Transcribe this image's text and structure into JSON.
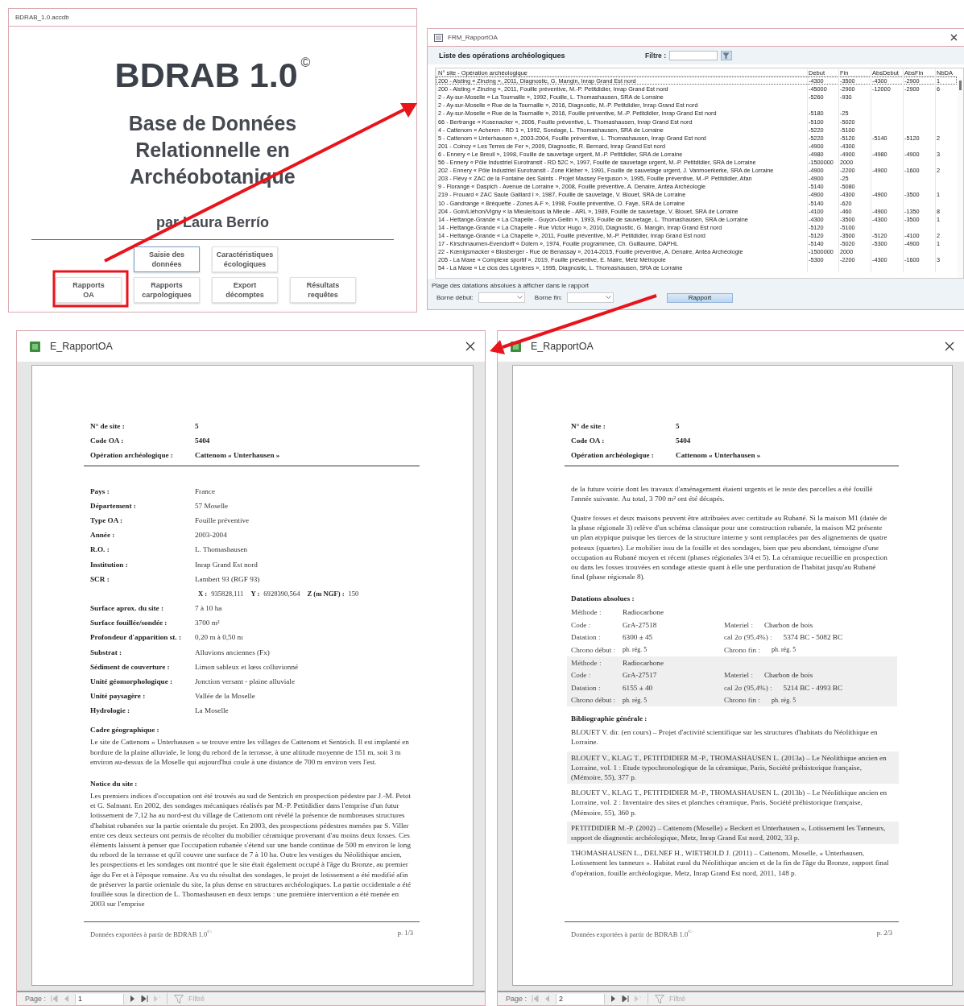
{
  "main_window": {
    "title": "BDRAB_1.0.accdb",
    "app_name": "BDRAB 1.0",
    "copyright": "©",
    "subtitle_lines": [
      "Base de Données",
      "Relationnelle en",
      "Archéobotanique"
    ],
    "author": "par Laura Berrío",
    "button_rows": [
      [
        {
          "label": "Saisie des\ndonnées",
          "focused": true
        },
        {
          "label": "Caractéristiques\nécologiques",
          "focused": false
        }
      ],
      [
        {
          "label": "Rapports\nOA",
          "focused": false
        },
        {
          "label": "Rapports\ncarpologiques",
          "focused": false
        },
        {
          "label": "Export\ndécomptes",
          "focused": false
        },
        {
          "label": "Résultats\nrequêtes",
          "focused": false
        }
      ]
    ]
  },
  "form_window": {
    "title": "FRM_RapportOA",
    "heading": "Liste des opérations archéologiques",
    "filter_label": "Filtre :",
    "table": {
      "columns": [
        "N° site - Opération archéologique",
        "Debut",
        "Fin",
        "AbsDebut",
        "AbsFin",
        "NbDA"
      ],
      "rows": [
        {
          "selected": true,
          "op": "200 - Alsting « Zinzing », 2011, Diagnostic, G. Mangin, Inrap Grand Est nord",
          "debut": "-4300",
          "fin": "-3500",
          "abs_debut": "-4300",
          "abs_fin": "-2900",
          "nbda": "1"
        },
        {
          "selected": false,
          "op": "200 - Alsting « Zinzing », 2011, Fouille préventive, M.-P. Petitdidier, Inrap Grand Est nord",
          "debut": "-45000",
          "fin": "-2900",
          "abs_debut": "-12000",
          "abs_fin": "-2900",
          "nbda": "6"
        },
        {
          "selected": false,
          "op": "2 - Ay-sur-Moselle « La Tournaille », 1992, Fouille, L. Thomashausen, SRA de Lorraine",
          "debut": "-5260",
          "fin": "-930"
        },
        {
          "selected": false,
          "op": "2 - Ay-sur-Moselle « Rue de la Tournaille », 2016, Diagnostic, M.-P. Petitdidier, Inrap Grand Est nord"
        },
        {
          "selected": false,
          "op": "2 - Ay-sur-Moselle « Rue de la Tournaille », 2016, Fouille préventive, M.-P. Petitdidier, Inrap Grand Est nord",
          "debut": "-5180",
          "fin": "-25"
        },
        {
          "selected": false,
          "op": "66 - Bertrange « Kosenacker », 2006, Fouille préventive, L. Thomashausen, Inrap Grand Est nord",
          "debut": "-5100",
          "fin": "-5020"
        },
        {
          "selected": false,
          "op": "4 - Cattenom « Acheren - RD 1 », 1992, Sondage, L. Thomashausen, SRA de Lorraine",
          "debut": "-5220",
          "fin": "-5100"
        },
        {
          "selected": false,
          "op": "5 - Cattenom « Unterhausen », 2003-2004, Fouille préventive, L. Thomashausen, Inrap Grand Est nord",
          "debut": "-5220",
          "fin": "-5120",
          "abs_debut": "-5140",
          "abs_fin": "-5120",
          "nbda": "2"
        },
        {
          "selected": false,
          "op": "201 - Coincy « Les Terres de Fer », 2009, Diagnostic, R. Bernard, Inrap Grand Est nord",
          "debut": "-4900",
          "fin": "-4300"
        },
        {
          "selected": false,
          "op": "6 - Ennery « Le Breuil », 1998, Fouille de sauvetage urgent, M.-P. Petitdidier, SRA de Lorraine",
          "debut": "-4980",
          "fin": "-4900",
          "abs_debut": "-4980",
          "abs_fin": "-4900",
          "nbda": "3"
        },
        {
          "selected": false,
          "op": "56 - Ennery « Pôle Industriel Eurotransit - RD 52C », 1997, Fouille de sauvetage urgent, M.-P. Petitdidier, SRA de Lorraine",
          "debut": "-1500000",
          "fin": "2000"
        },
        {
          "selected": false,
          "op": "202 - Ennery « Pôle Industriel Eurotransit - Zone Kléber », 1991, Fouille de sauvetage urgent, J. Vanmoerkerke, SRA de Lorraine",
          "debut": "-4900",
          "fin": "-2200",
          "abs_debut": "-4900",
          "abs_fin": "-1600",
          "nbda": "2"
        },
        {
          "selected": false,
          "op": "203 - Flévy « ZAC de la Fontaine des Saints - Projet Massey Ferguson », 1995, Fouille préventive, M.-P. Petitdidier, Afan",
          "debut": "-4900",
          "fin": "-25"
        },
        {
          "selected": false,
          "op": "9 - Florange « Daspich - Avenue de Lorraine », 2008, Fouille préventive, A. Denaire, Antéa Archéologie",
          "debut": "-5140",
          "fin": "-5080"
        },
        {
          "selected": false,
          "op": "219 - Frouard « ZAC Saule Gaillard I », 1987, Fouille de sauvetage, V. Blouet, SRA de Lorraine",
          "debut": "-4900",
          "fin": "-4300",
          "abs_debut": "-4900",
          "abs_fin": "-3500",
          "nbda": "1"
        },
        {
          "selected": false,
          "op": "10 - Gandrange « Bréquette - Zones A-F », 1998, Fouille préventive, O. Faye, SRA de Lorraine",
          "debut": "-5140",
          "fin": "-620"
        },
        {
          "selected": false,
          "op": "204 - Goin/Liéhon/Vigny « la Mieule/sous la Mieule - ARL », 1989, Fouille de sauvetage, V. Blouet, SRA de Lorraine",
          "debut": "-4100",
          "fin": "-460",
          "abs_debut": "-4900",
          "abs_fin": "-1350",
          "nbda": "8"
        },
        {
          "selected": false,
          "op": "14 - Hettange-Grande « La Chapelle - Guyon-Gellin », 1993, Fouille de sauvetage, L. Thomashausen, SRA de Lorraine",
          "debut": "-4300",
          "fin": "-3500",
          "abs_debut": "-4300",
          "abs_fin": "-3500",
          "nbda": "1"
        },
        {
          "selected": false,
          "op": "14 - Hettange-Grande « La Chapelle - Rue Victor Hugo », 2010, Diagnostic, G. Mangin, Inrap Grand Est nord",
          "debut": "-5120",
          "fin": "-5100"
        },
        {
          "selected": false,
          "op": "14 - Hettange-Grande « La Chapelle », 2011, Fouille préventive, M.-P. Petitdidier, Inrap Grand Est nord",
          "debut": "-5120",
          "fin": "-3500",
          "abs_debut": "-5120",
          "abs_fin": "-4100",
          "nbda": "2"
        },
        {
          "selected": false,
          "op": "17 - Kirschnaumen-Evendorff « Dolem », 1974, Fouille programmée, Ch. Guillaume, DAPHL",
          "debut": "-5140",
          "fin": "-5020",
          "abs_debut": "-5300",
          "abs_fin": "-4900",
          "nbda": "1"
        },
        {
          "selected": false,
          "op": "22 - Kœnigsmacker « Blosberger - Rue de Benassay », 2014-2015, Fouille préventive, A. Denaire, Antéa Archéologie",
          "debut": "-1500000",
          "fin": "2000"
        },
        {
          "selected": false,
          "op": "205 - La Maxe « Complexe sportif », 2019, Fouille préventive, E. Maire, Metz Métropole",
          "debut": "-5300",
          "fin": "-2200",
          "abs_debut": "-4300",
          "abs_fin": "-1600",
          "nbda": "3"
        },
        {
          "selected": false,
          "op": "54 - La Maxe « Le clos des Lignières », 1995, Diagnostic, L. Thomashausen, SRA de Lorraine"
        }
      ]
    },
    "range_label": "Plage des datations absolues à afficher dans le rapport",
    "start_label": "Borne début:",
    "end_label": "Borne fin:",
    "report_button": "Rapport"
  },
  "reports": [
    {
      "title": "E_RapportOA",
      "header": [
        {
          "label": "N° de site :",
          "value": "5"
        },
        {
          "label": "Code OA :",
          "value": "5404"
        },
        {
          "label": "Opération archéologique :",
          "value": "Cattenom « Unterhausen »"
        }
      ],
      "blocks": [
        {
          "kind": "fields",
          "items": [
            {
              "label": "Pays :",
              "value": "France"
            },
            {
              "label": "Département :",
              "value": "57 Moselle"
            },
            {
              "label": "Type OA :",
              "value": "Fouille préventive"
            },
            {
              "label": "Année :",
              "value": "2003-2004"
            },
            {
              "label": "R.O. :",
              "value": "L. Thomashausen"
            },
            {
              "label": "Institution :",
              "value": "Inrap Grand Est nord"
            },
            {
              "label": "SCR :",
              "value": "Lambert 93 (RGF 93)"
            }
          ]
        },
        {
          "kind": "coords",
          "items": [
            {
              "label": "X :",
              "value": "935828,111"
            },
            {
              "label": "Y :",
              "value": "6928390,564"
            },
            {
              "label": "Z (m NGF) :",
              "value": "150"
            }
          ]
        },
        {
          "kind": "fields",
          "items": [
            {
              "label": "Surface aprox. du site :",
              "value": "7 à 10 ha"
            },
            {
              "label": "Surface fouillée/sondée :",
              "value": "3700 m²"
            },
            {
              "label": "Profondeur d'apparition st. :",
              "value": "0,20 m à 0,50 m"
            },
            {
              "label": "Substrat :",
              "value": "Alluvions anciennes (Fx)"
            },
            {
              "label": "Sédiment de couverture :",
              "value": "Limon sableux et lœss colluvionné"
            },
            {
              "label": "Unité géomorphologique :",
              "value": "Jonction versant - plaine alluviale"
            },
            {
              "label": "Unité paysagère :",
              "value": "Vallée de la Moselle"
            },
            {
              "label": "Hydrologie :",
              "value": "La Moselle"
            }
          ]
        },
        {
          "kind": "heading",
          "text": "Cadre géographique :"
        },
        {
          "kind": "paragraph",
          "text": "Le site de Cattenom « Unterhausen » se trouve entre les villages de Cattenom et Sentzich. Il est implanté en bordure de la plaine alluviale, le long du rebord de la terrasse, à une altitude moyenne de 151 m, soit 3 m environ au-dessus de la Moselle qui aujourd'hui coule à une distance de 700 m environ vers l'est."
        },
        {
          "kind": "heading",
          "text": "Notice du site :"
        },
        {
          "kind": "paragraph",
          "text": "Les premiers indices d'occupation ont été trouvés au sud de Sentzich en prospection pédestre par J.-M. Petot et G. Salmant. En 2002, des sondages mécaniques réalisés par M.-P. Petitdidier dans l'emprise d'un futur lotissement de 7,12 ha au nord-est du village de Cattenom ont révélé la présence de nombreuses structures d'habitat rubanées sur la partie orientale du projet. En 2003, des prospections pédestres menées par S. Viller entre ces deux secteurs ont permis de récolter du mobilier céramique provenant d'au moins deux fosses. Ces éléments laissent à penser que l'occupation rubanée s'étend sur une bande continue de 500 m environ le long du rebord de la terrasse et qu'il couvre une surface de 7 à 10 ha. Outre les vestiges du Néolithique ancien, les prospections et les sondages ont montré que le site était également occupé à l'âge du Bronze, au premier âge du Fer et à l'époque romaine. Au vu du résultat des sondages, le projet de lotissement a été modifié afin de préserver la partie orientale du site, la plus dense en structures archéologiques. La partie occidentale a été fouillée sous la direction de L. Thomashausen en deux temps : une première intervention a été menée en 2003 sur l'emprise"
        }
      ],
      "footer": {
        "text": "Données exportées à partir de BDRAB 1.0$^{©}$",
        "page": "p. 1/3"
      },
      "nav": {
        "label": "Page :",
        "record": "1",
        "filter": "Filtré"
      }
    },
    {
      "title": "E_RapportOA",
      "header": [
        {
          "label": "N° de site :",
          "value": "5"
        },
        {
          "label": "Code OA :",
          "value": "5404"
        },
        {
          "label": "Opération archéologique :",
          "value": "Cattenom « Unterhausen »"
        }
      ],
      "blocks": [
        {
          "kind": "paragraph",
          "text": "de la future voirie dont les travaux d'aménagement étaient urgents et le reste des parcelles a été fouillé l'année suivante. Au total, 3 700 m² ont été décapés."
        },
        {
          "kind": "paragraph",
          "text": "Quatre fosses et deux maisons peuvent être attribuées avec certitude au Rubané. Si la maison M1 (datée de la phase régionale 3) relève d'un schéma classique pour une construction rubanée, la maison M2 présente un plan atypique puisque les tierces de la structure interne y sont remplacées par des alignements de quatre poteaux (quartes). Le mobilier issu de la fouille et des sondages, bien que peu abondant, témoigne d'une occupation au Rubané moyen et récent (phases régionales 3/4 et 5). La céramique recueillie en prospection ou dans les fosses trouvées en sondage atteste quant à elle une perduration de l'habitat jusqu'au Rubané final (phase régionale 8)."
        },
        {
          "kind": "heading",
          "text": "Datations absolues :"
        },
        {
          "kind": "dating",
          "shaded": false,
          "method_label": "Méthode :",
          "method": "Radiocarbone",
          "code_label": "Code :",
          "code": "GrA-27518",
          "material_label": "Materiel :",
          "material": "Charbon de bois",
          "date_label": "Datation :",
          "date": "6300 ± 45",
          "cal_label": "cal 2σ (95,4%) :",
          "cal": "5374 BC - 5082 BC",
          "start_label": "Chrono début :",
          "start": "ph. rég. 5",
          "end_label": "Chrono fin :",
          "end": "ph. rég. 5"
        },
        {
          "kind": "dating",
          "shaded": true,
          "method_label": "Méthode :",
          "method": "Radiocarbone",
          "code_label": "Code :",
          "code": "GrA-27517",
          "material_label": "Materiel :",
          "material": "Charbon de bois",
          "date_label": "Datation :",
          "date": "6155 ± 40",
          "cal_label": "cal 2σ (95,4%) :",
          "cal": "5214 BC - 4993 BC",
          "start_label": "Chrono début :",
          "start": "ph. rég. 5",
          "end_label": "Chrono fin :",
          "end": "ph. rég. 5"
        },
        {
          "kind": "heading",
          "text": "Bibliographie générale :"
        },
        {
          "kind": "bib",
          "shaded": false,
          "text": "BLOUET V. dir. (en cours) – Projet d'activité scientifique sur les structures d'habitats du Néolithique en Lorraine."
        },
        {
          "kind": "bib",
          "shaded": true,
          "text": "BLOUET V., KLAG T., PETITDIDIER M.-P., THOMASHAUSEN L. (2013a) – Le Néolithique ancien en Lorraine, vol. 1 : Etude typochronologique de la céramique, Paris, Société préhistorique française, (Mémoire, 55), 377 p."
        },
        {
          "kind": "bib",
          "shaded": false,
          "text": "BLOUET V., KLAG T., PETITDIDIER M.-P., THOMASHAUSEN L. (2013b) – Le Néolithique ancien en Lorraine, vol. 2 : Inventaire des sites et planches céramique, Paris, Société préhistorique française, (Mémoire, 55), 360 p."
        },
        {
          "kind": "bib",
          "shaded": true,
          "text": "PETITDIDIER M.-P. (2002) – Cattenom (Moselle) « Beckert et Unterhausen », Lotissement les Tanneurs, rapport de diagnostic archéologique, Metz, Inrap Grand Est nord, 2002, 33 p."
        },
        {
          "kind": "bib",
          "shaded": false,
          "text": "THOMASHAUSEN L., DELNEF H., WIETHOLD J. (2011) – Cattenom, Moselle, « Unterhausen, Lotissement les tanneurs ». Habitat rural du Néolithique ancien et de la fin de l'âge du Bronze, rapport final d'opération, fouille archéologique, Metz, Inrap Grand Est nord, 2011, 148 p."
        }
      ],
      "footer": {
        "text": "Données exportées à partir de BDRAB 1.0$^{©}$",
        "page": "p. 2/3"
      },
      "nav": {
        "label": "Page :",
        "record": "2",
        "filter": "Filtré"
      }
    }
  ]
}
